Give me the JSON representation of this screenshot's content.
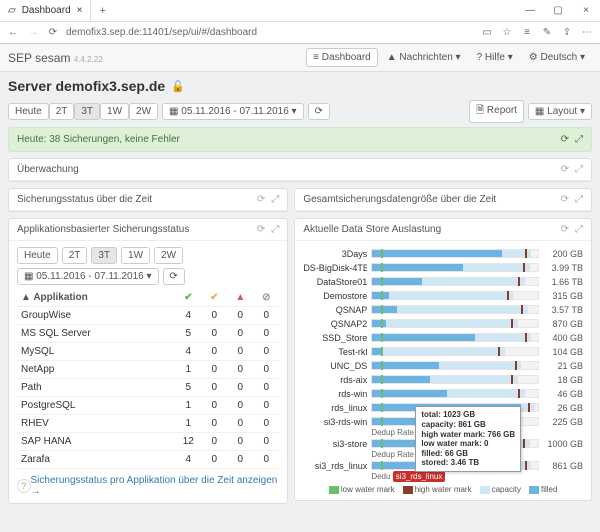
{
  "browser": {
    "tab": "Dashboard",
    "url": "demofix3.sep.de:11401/sep/ui/#/dashboard"
  },
  "brand": {
    "name": "SEP sesam",
    "ver": "4.4.2.22"
  },
  "topnav": {
    "dashboard": "Dashboard",
    "nachrichten": "Nachrichten",
    "hilfe": "Hilfe",
    "deutsch": "Deutsch"
  },
  "server": {
    "label": "Server",
    "host": "demofix3.sep.de"
  },
  "range": {
    "buttons": [
      "Heute",
      "2T",
      "3T",
      "1W",
      "2W"
    ],
    "active": 2,
    "date": "05.11.2016 - 07.11.2016",
    "report": "Report",
    "layout": "Layout"
  },
  "alert": {
    "text": "Heute: 38 Sicherungen, keine Fehler"
  },
  "panels": {
    "watch": "Überwachung",
    "status_time": "Sicherungsstatus über die Zeit",
    "total_time": "Gesamtsicherungsdatengröße über die Zeit",
    "app_status": "Applikationsbasierter Sicherungsstatus",
    "ds_util": "Aktuelle Data Store Auslastung"
  },
  "app_table": {
    "cols": {
      "app": "Applikation"
    },
    "link": "Sicherungsstatus pro Applikation über die Zeit anzeigen →",
    "rows": [
      {
        "n": "GroupWise",
        "a": 4,
        "b": 0,
        "c": 0,
        "d": 0
      },
      {
        "n": "MS SQL Server",
        "a": 5,
        "b": 0,
        "c": 0,
        "d": 0
      },
      {
        "n": "MySQL",
        "a": 4,
        "b": 0,
        "c": 0,
        "d": 0
      },
      {
        "n": "NetApp",
        "a": 1,
        "b": 0,
        "c": 0,
        "d": 0
      },
      {
        "n": "Path",
        "a": 5,
        "b": 0,
        "c": 0,
        "d": 0
      },
      {
        "n": "PostgreSQL",
        "a": 1,
        "b": 0,
        "c": 0,
        "d": 0
      },
      {
        "n": "RHEV",
        "a": 1,
        "b": 0,
        "c": 0,
        "d": 0
      },
      {
        "n": "SAP HANA",
        "a": 12,
        "b": 0,
        "c": 0,
        "d": 0
      },
      {
        "n": "Zarafa",
        "a": 4,
        "b": 0,
        "c": 0,
        "d": 0
      }
    ]
  },
  "chart_data": {
    "type": "bar",
    "title": "Aktuelle Data Store Auslastung",
    "series": [
      {
        "name": "3Days",
        "capacity": "200 GB",
        "fill_pct": 78,
        "cap_pct": 96
      },
      {
        "name": "DS-BigDisk-4TB",
        "capacity": "3.99 TB",
        "fill_pct": 55,
        "cap_pct": 95
      },
      {
        "name": "DataStore01",
        "capacity": "1.66 TB",
        "fill_pct": 30,
        "cap_pct": 92
      },
      {
        "name": "Demostore",
        "capacity": "315 GB",
        "fill_pct": 10,
        "cap_pct": 85
      },
      {
        "name": "QSNAP",
        "capacity": "3.57 TB",
        "fill_pct": 15,
        "cap_pct": 94
      },
      {
        "name": "QSNAP2",
        "capacity": "870 GB",
        "fill_pct": 8,
        "cap_pct": 88
      },
      {
        "name": "SSD_Store",
        "capacity": "400 GB",
        "fill_pct": 62,
        "cap_pct": 96
      },
      {
        "name": "Test-rkl",
        "capacity": "104 GB",
        "fill_pct": 5,
        "cap_pct": 80
      },
      {
        "name": "UNC_DS",
        "capacity": "21 GB",
        "fill_pct": 40,
        "cap_pct": 90
      },
      {
        "name": "rds-aix",
        "capacity": "18 GB",
        "fill_pct": 35,
        "cap_pct": 88
      },
      {
        "name": "rds-win",
        "capacity": "46 GB",
        "fill_pct": 45,
        "cap_pct": 92
      },
      {
        "name": "rds_linux",
        "capacity": "26 GB",
        "fill_pct": 90,
        "cap_pct": 98
      },
      {
        "name": "si3-rds-win",
        "capacity": "225 GB",
        "fill_pct": 55,
        "cap_pct": 90,
        "dedup": "Dedup Rate 27,4 : 1"
      },
      {
        "name": "si3-store",
        "capacity": "1000 GB",
        "fill_pct": 60,
        "cap_pct": 95,
        "dedup": "Dedup Rate 27,7 : 1"
      },
      {
        "name": "si3_rds_linux",
        "capacity": "861 GB",
        "fill_pct": 70,
        "cap_pct": 96,
        "chip": "si3_rds_linux"
      }
    ],
    "tooltip": {
      "lines": [
        "total: 1023 GB",
        "capacity: 861 GB",
        "high water mark: 766 GB",
        "low water mark: 0",
        "filled: 66 GB",
        "stored: 3.46 TB"
      ]
    },
    "legend": {
      "lw": "low water mark",
      "hw": "high water mark",
      "cap": "capacity",
      "fill": "filled"
    }
  }
}
